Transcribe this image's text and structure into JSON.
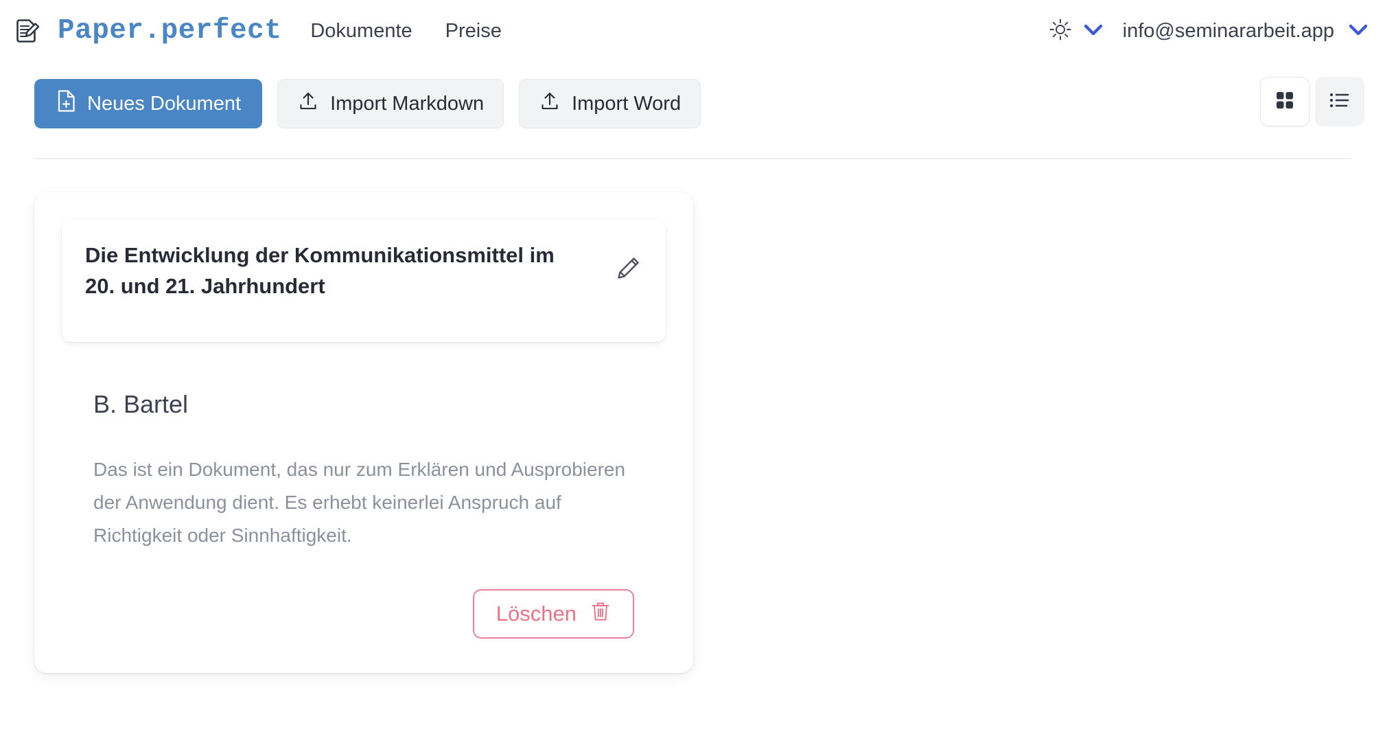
{
  "header": {
    "brand_icon": "document-pencil-icon",
    "brand_name": "Paper.perfect",
    "nav": [
      {
        "label": "Dokumente",
        "name": "nav-link-dokumente"
      },
      {
        "label": "Preise",
        "name": "nav-link-preise"
      }
    ],
    "theme": {
      "icon": "sun-icon",
      "chevron": "chevron-down-icon"
    },
    "user": {
      "email": "info@seminararbeit.app",
      "chevron": "chevron-down-icon"
    }
  },
  "toolbar": {
    "new_document_label": "Neues Dokument",
    "new_document_icon": "file-plus-icon",
    "import_markdown_label": "Import Markdown",
    "import_markdown_icon": "upload-icon",
    "import_word_label": "Import Word",
    "import_word_icon": "upload-icon",
    "view_grid_icon": "grid-view-icon",
    "view_list_icon": "list-view-icon",
    "active_view": "grid"
  },
  "documents": [
    {
      "title": "Die Entwicklung der Kommunikationsmittel im 20. und 21. Jahrhundert",
      "author": "B. Bartel",
      "description": "Das ist ein Dokument, das nur zum Erklären und Ausprobieren der Anwendung dient. Es erhebt keinerlei Anspruch auf Richtigkeit oder Sinnhaftigkeit.",
      "edit_icon": "pencil-icon",
      "delete_label": "Löschen",
      "delete_icon": "trash-icon"
    }
  ],
  "colors": {
    "brand_blue": "#4a86c5",
    "chevron_blue": "#3b58d8",
    "text_dark": "#262b36",
    "text_muted": "#8a909e",
    "danger": "#ef7187",
    "surface_gray": "#f2f3f5"
  }
}
